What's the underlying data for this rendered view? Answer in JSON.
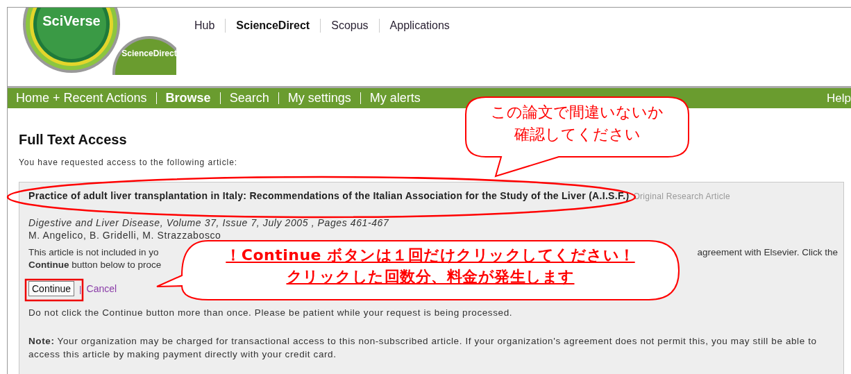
{
  "header": {
    "logo_primary": "SciVerse",
    "logo_secondary": "ScienceDirect",
    "links": [
      {
        "label": "Hub",
        "selected": false
      },
      {
        "label": "ScienceDirect",
        "selected": true
      },
      {
        "label": "Scopus",
        "selected": false
      },
      {
        "label": "Applications",
        "selected": false
      }
    ]
  },
  "nav": {
    "items": [
      {
        "label": "Home + Recent Actions",
        "selected": false
      },
      {
        "label": "Browse",
        "selected": true
      },
      {
        "label": "Search",
        "selected": false
      },
      {
        "label": "My settings",
        "selected": false
      },
      {
        "label": "My alerts",
        "selected": false
      }
    ],
    "help": "Help"
  },
  "page": {
    "title": "Full Text Access",
    "intro": "You have requested access to the following article:"
  },
  "article": {
    "title": "Practice of adult liver transplantation in Italy: Recommendations of the Italian Association for the Study of the Liver (A.I.S.F.)",
    "type": "Original Research Article",
    "source": "Digestive and Liver Disease, Volume 37, Issue 7, July 2005 , Pages 461-467",
    "authors": "M. Angelico, B. Gridelli, M. Strazzabosco",
    "notice_start": "This article is not included in yo",
    "notice_end": "agreement with Elsevier. Click the",
    "notice_line2": "**Continue** button below to proce",
    "continue": "Continue",
    "link_separator": "|",
    "cancel": "Cancel",
    "warning": "Do not click the Continue button more than once. Please be patient while your request is being processed.",
    "note": "**Note:** Your organization may be charged for transactional access to this non-subscribed article. If your organization's agreement does not permit this, you may still be able to access this article by making payment directly with your credit card."
  },
  "callouts": [
    {
      "lines": [
        "この論文で間違いないか",
        "確認してください"
      ],
      "emphasis": false
    },
    {
      "lines": [
        "！Continue  ボタンは１回だけクリックしてください！",
        "クリックした回数分、料金が発生します"
      ],
      "emphasis": true
    }
  ]
}
